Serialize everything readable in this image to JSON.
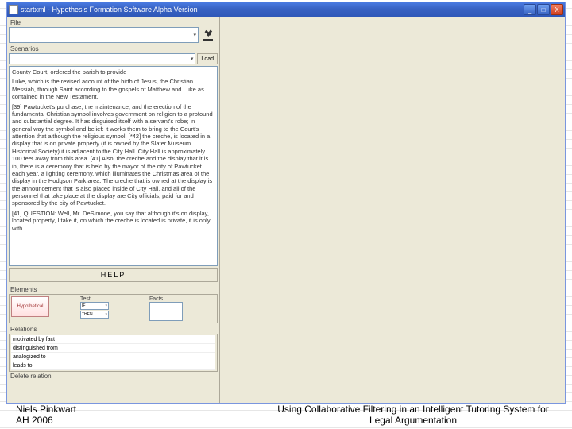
{
  "window": {
    "title": "startxml - Hypothesis Formation Software Alpha Version",
    "min": "_",
    "max": "□",
    "close": "X"
  },
  "panel": {
    "file_label": "File",
    "scenario_label": "Scenarios",
    "scenario_btn": "Load",
    "help_label": "HELP",
    "elements_label": "Elements",
    "hypo_label": "Hypothetical",
    "test_label": "Test",
    "if_label": "IF",
    "then_label": "THEN",
    "facts_label": "Facts",
    "relations_label": "Relations",
    "rel1": "motivated by fact",
    "rel2": "distinguished from",
    "rel3": "analogized to",
    "rel4": "leads to",
    "delete_label": "Delete relation"
  },
  "doc": {
    "p1": "County Court, ordered the parish to provide",
    "p2": "Luke, which is the revised account of the birth of Jesus, the Christian Messiah, through Saint according to the gospels of Matthew and Luke as contained in the New Testament.",
    "p3": "[39] Pawtucket's purchase, the maintenance, and the erection of the fundamental Christian symbol involves government on religion to a profound and substantial degree. It has disguised itself with a servant's robe; in general way the symbol and belief: it works them to bring to the Court's attention that although the religious symbol, [*42] the creche, is located in a display that is on private property (it is owned by the Slater Museum Historical Society) it is adjacent to the City Hall. City Hall is approximately 100 feet away from this area. [41] Also, the creche and the display that it is in, there is a ceremony that is held by the mayor of the city of Pawtucket each year, a lighting ceremony, which illuminates the Christmas area of the display in the Hodgson Park area. The creche that is owned at the display is the announcement that is also placed inside of City Hall, and all of the personnel that take place at the display are City officials, paid for and sponsored by the city of Pawtucket.",
    "p4": "[41] QUESTION: Well, Mr. DeSimone, you say that although it's on display, located property, I take it, on which the creche is located is private, it is only with"
  },
  "footer": {
    "author": "Niels Pinkwart",
    "venue": "AH 2006",
    "title": "Using Collaborative Filtering in an Intelligent Tutoring System for Legal Argumentation"
  }
}
